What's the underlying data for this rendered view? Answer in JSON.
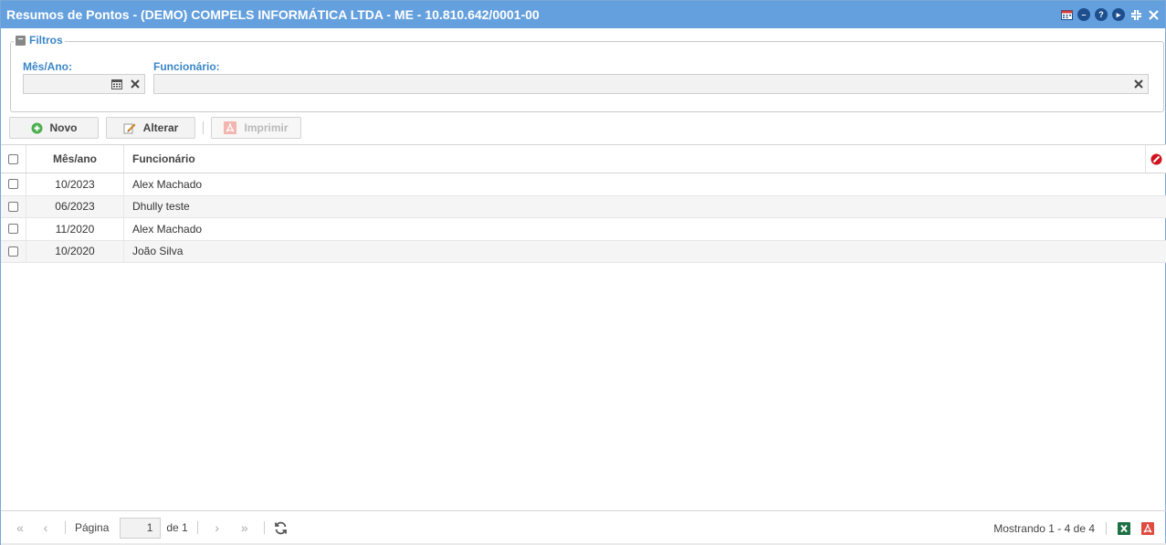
{
  "window": {
    "title": "Resumos de Pontos - (DEMO) COMPELS INFORMÁTICA LTDA - ME - 10.810.642/0001-00",
    "tools": [
      "calendar-icon",
      "minimize-icon",
      "help-icon",
      "next-icon",
      "collapse-icon",
      "close-icon"
    ]
  },
  "filters": {
    "legend": "Filtros",
    "mes_ano_label": "Mês/Ano:",
    "mes_ano_value": "",
    "funcionario_label": "Funcionário:",
    "funcionario_value": ""
  },
  "toolbar": {
    "novo": "Novo",
    "alterar": "Alterar",
    "imprimir": "Imprimir"
  },
  "grid": {
    "columns": [
      "Mês/ano",
      "Funcionário"
    ],
    "rows": [
      {
        "mes_ano": "10/2023",
        "funcionario": "Alex Machado"
      },
      {
        "mes_ano": "06/2023",
        "funcionario": "Dhully teste"
      },
      {
        "mes_ano": "11/2020",
        "funcionario": "Alex Machado"
      },
      {
        "mes_ano": "10/2020",
        "funcionario": "João Silva"
      }
    ]
  },
  "pager": {
    "page_label": "Página",
    "page_value": "1",
    "of_label": "de 1",
    "showing": "Mostrando 1 - 4 de 4"
  },
  "colors": {
    "titlebar": "#64a0de",
    "accent_label": "#3a86c8",
    "excel": "#1e7145",
    "pdf": "#e04a3f",
    "novo_icon": "#4caf50"
  }
}
